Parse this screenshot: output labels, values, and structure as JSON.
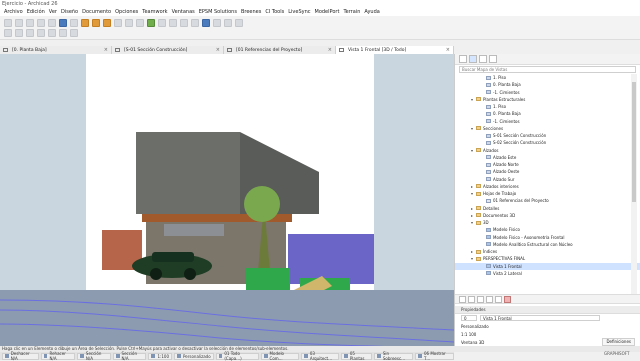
{
  "app": {
    "title": "Ejercicio - Archicad 26",
    "menu": [
      "Archivo",
      "Edición",
      "Ver",
      "Diseño",
      "Documento",
      "Opciones",
      "Teamwork",
      "Ventanas",
      "EPSM Solutions",
      "Breenes",
      "CI Tools",
      "LiveSync",
      "ModelPort",
      "Terrain",
      "Ayuda"
    ]
  },
  "tabs": [
    {
      "label": "[0. Planta Baja]",
      "active": false
    },
    {
      "label": "[S-01 Sección Construcción]",
      "active": false
    },
    {
      "label": "[01 Referencias del Proyecto]",
      "active": false
    },
    {
      "label": "Vista 1 Frontal [3D / Todo]",
      "active": true
    }
  ],
  "panel": {
    "search_placeholder": "Buscar Mapa de Vistas",
    "tree": [
      {
        "label": "1. Piso",
        "indent": 2,
        "icon": "view"
      },
      {
        "label": "0. Planta Baja",
        "indent": 2,
        "icon": "view"
      },
      {
        "label": "-1. Cimientos",
        "indent": 2,
        "icon": "view"
      },
      {
        "label": "Plantas Estructurales",
        "indent": 1,
        "icon": "folder",
        "caret": "▾"
      },
      {
        "label": "1. Piso",
        "indent": 2,
        "icon": "view"
      },
      {
        "label": "0. Planta Baja",
        "indent": 2,
        "icon": "view"
      },
      {
        "label": "-1. Cimientos",
        "indent": 2,
        "icon": "view"
      },
      {
        "label": "Secciones",
        "indent": 1,
        "icon": "folder",
        "caret": "▾"
      },
      {
        "label": "S-01 Sección Construcción",
        "indent": 2,
        "icon": "view"
      },
      {
        "label": "S-02 Sección Construcción",
        "indent": 2,
        "icon": "view"
      },
      {
        "label": "Alzados",
        "indent": 1,
        "icon": "folder",
        "caret": "▾"
      },
      {
        "label": "Alzado Este",
        "indent": 2,
        "icon": "view"
      },
      {
        "label": "Alzado Norte",
        "indent": 2,
        "icon": "view"
      },
      {
        "label": "Alzado Oeste",
        "indent": 2,
        "icon": "view"
      },
      {
        "label": "Alzado Sur",
        "indent": 2,
        "icon": "view"
      },
      {
        "label": "Alzados interiores",
        "indent": 1,
        "icon": "folder",
        "caret": "▸"
      },
      {
        "label": "Hojas de Trabajo",
        "indent": 1,
        "icon": "folder",
        "caret": "▾"
      },
      {
        "label": "01 Referencias del Proyecto",
        "indent": 2,
        "icon": "sheet"
      },
      {
        "label": "Detalles",
        "indent": 1,
        "icon": "folder",
        "caret": "▸"
      },
      {
        "label": "Documentos 3D",
        "indent": 1,
        "icon": "folder",
        "caret": "▸"
      },
      {
        "label": "3D",
        "indent": 1,
        "icon": "folder",
        "caret": "▾"
      },
      {
        "label": "Modelo Físico",
        "indent": 2,
        "icon": "view3d"
      },
      {
        "label": "Modelo Físico - Axonometría Frontal",
        "indent": 2,
        "icon": "view3d"
      },
      {
        "label": "Modelo Analítico Estructural con Núcleo",
        "indent": 2,
        "icon": "view3d"
      },
      {
        "label": "Índices",
        "indent": 1,
        "icon": "folder",
        "caret": "▸"
      },
      {
        "label": "PERSPECTIVAS FINAL",
        "indent": 1,
        "icon": "folder",
        "caret": "▾"
      },
      {
        "label": "Vista 1 Frontal",
        "indent": 2,
        "icon": "view3d",
        "selected": true
      },
      {
        "label": "Vista 2 Lateral",
        "indent": 2,
        "icon": "view3d"
      }
    ],
    "properties_header": "Propiedades",
    "properties": {
      "id_value": "0",
      "name_value": "Vista 1 Frontal",
      "layer": "Personalizado",
      "scale": "1:1 100",
      "settings_btn": "Definiciones",
      "window_label": "Ventana 3D"
    }
  },
  "status_text": "Haga clic en un Elemento o dibuje un Área de Selección. Pulse Ctrl+Mayús para activar o desactivar la selección de elementos/sub-elementos.",
  "bottom_bar": [
    "Deshacer N/A",
    "Rehacer N/A",
    "Sección N/A",
    "Sección N/A",
    "1:100",
    "Personalizado",
    "01 Todo (Capa…)",
    "Modelo Com…",
    "03 Arquitect…",
    "05 Plantas",
    "Sin Sobreesc…",
    "06 Mostrar T…"
  ],
  "brand": "GRAPHISOFT",
  "colors": {
    "sky_side": "#c9d6df",
    "ground": "#8d9bb0",
    "concrete": "#6c6e6a",
    "stone_wall": "#7b756a",
    "purple_panel": "#6c65c8",
    "car": "#1f3d25",
    "vegetation": "#2fa84c"
  }
}
